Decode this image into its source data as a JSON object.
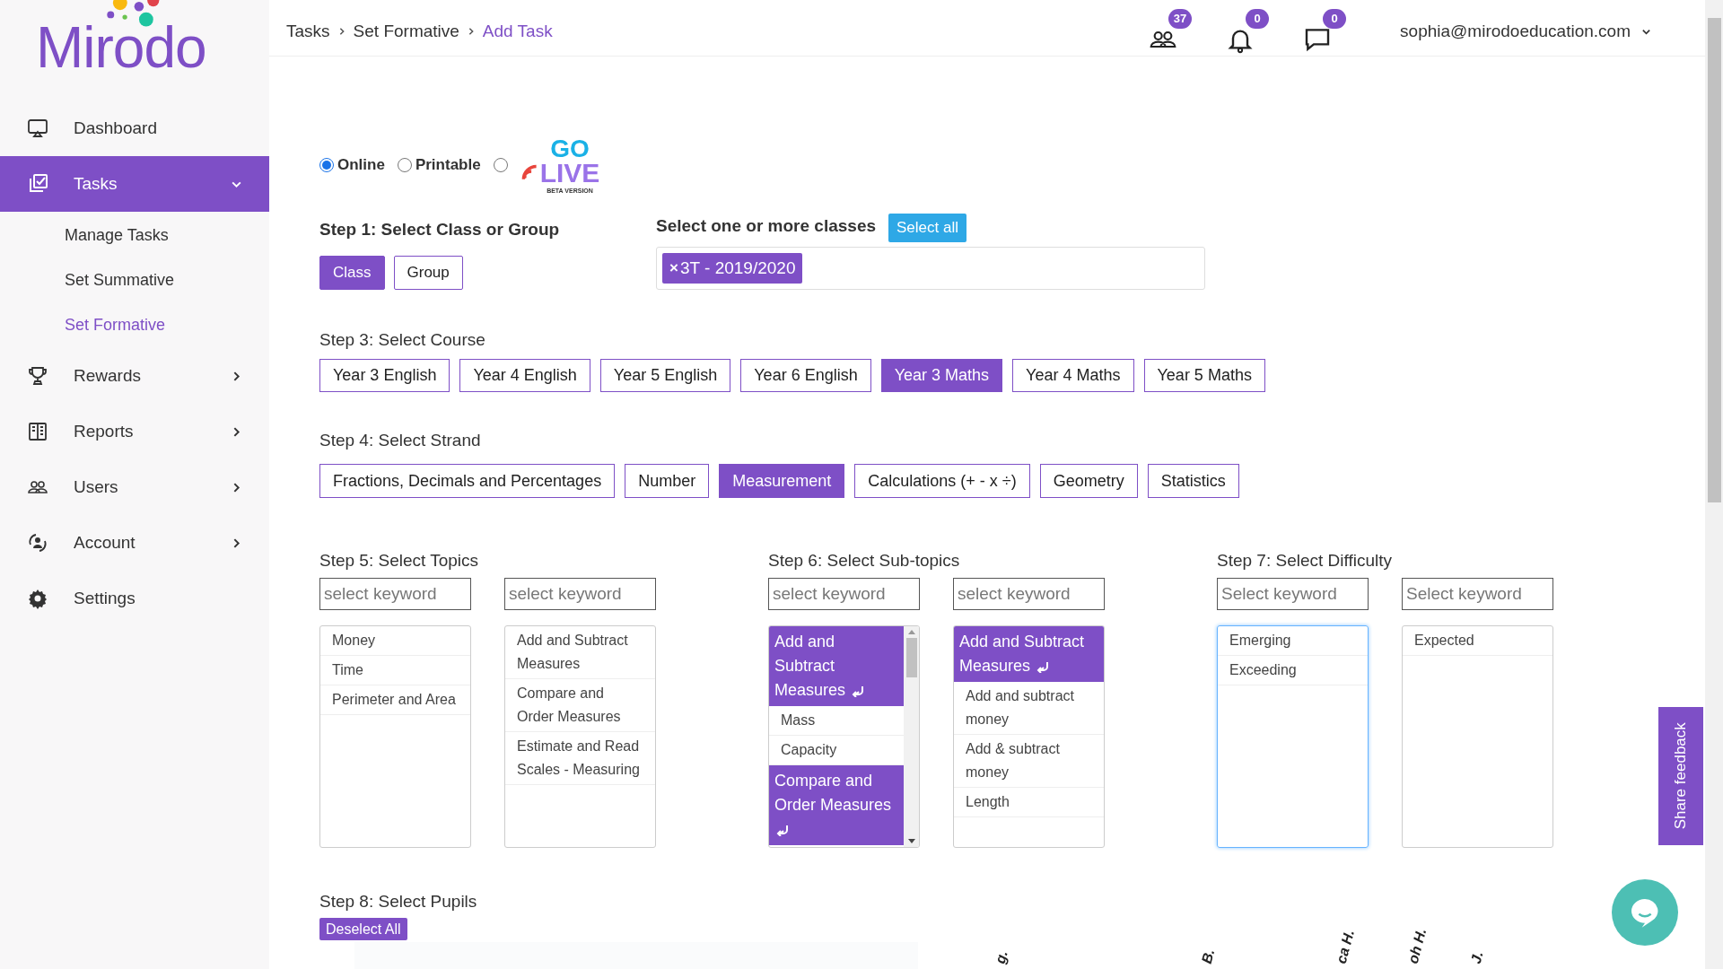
{
  "logo": {
    "text": "Mirodo"
  },
  "sidebar": {
    "items": [
      {
        "label": "Dashboard",
        "selected": false
      },
      {
        "label": "Tasks",
        "selected": true,
        "expanded": true,
        "children": [
          {
            "label": "Manage Tasks",
            "selected": false
          },
          {
            "label": "Set Summative",
            "selected": false
          },
          {
            "label": "Set Formative",
            "selected": true
          }
        ]
      },
      {
        "label": "Rewards",
        "selected": false,
        "expanded": false
      },
      {
        "label": "Reports",
        "selected": false,
        "expanded": false
      },
      {
        "label": "Users",
        "selected": false,
        "expanded": false
      },
      {
        "label": "Account",
        "selected": false,
        "expanded": false
      },
      {
        "label": "Settings",
        "selected": false
      }
    ]
  },
  "breadcrumb": [
    {
      "label": "Tasks",
      "current": false
    },
    {
      "label": "Set Formative",
      "current": false
    },
    {
      "label": "Add Task",
      "current": true
    }
  ],
  "header": {
    "badges": [
      {
        "count": "37"
      },
      {
        "count": "0"
      },
      {
        "count": "0"
      }
    ],
    "user": "sophia@mirodoeducation.com"
  },
  "modes": [
    {
      "kind": "text",
      "label": "Online",
      "selected": true
    },
    {
      "kind": "text",
      "label": "Printable",
      "selected": false
    },
    {
      "kind": "logo",
      "go": "GO",
      "live": "LIVE",
      "beta": "BETA VERSION",
      "selected": false
    }
  ],
  "step1": {
    "label": "Step 1: Select Class or Group",
    "options": [
      {
        "label": "Class",
        "selected": true
      },
      {
        "label": "Group",
        "selected": false
      }
    ]
  },
  "classes": {
    "label": "Select one or more classes",
    "select_all": "Select all",
    "tags": [
      {
        "remove": "×",
        "label": "3T - 2019/2020"
      }
    ]
  },
  "step3": {
    "label": "Step 3: Select Course",
    "options": [
      {
        "label": "Year 3 English",
        "selected": false
      },
      {
        "label": "Year 4 English",
        "selected": false
      },
      {
        "label": "Year 5 English",
        "selected": false
      },
      {
        "label": "Year 6 English",
        "selected": false
      },
      {
        "label": "Year 3 Maths",
        "selected": true
      },
      {
        "label": "Year 4 Maths",
        "selected": false
      },
      {
        "label": "Year 5 Maths",
        "selected": false
      }
    ]
  },
  "step4": {
    "label": "Step 4: Select Strand",
    "options": [
      {
        "label": "Fractions, Decimals and Percentages",
        "selected": false
      },
      {
        "label": "Number",
        "selected": false
      },
      {
        "label": "Measurement",
        "selected": true
      },
      {
        "label": "Calculations (+ - x ÷)",
        "selected": false
      },
      {
        "label": "Geometry",
        "selected": false
      },
      {
        "label": "Statistics",
        "selected": false
      }
    ]
  },
  "pickers": [
    {
      "label": "Step 5: Select Topics",
      "lists": [
        {
          "placeholder": "select keyword",
          "focused": false,
          "scrollbar": false,
          "items": [
            {
              "kind": "item",
              "label": "Money"
            },
            {
              "kind": "item",
              "label": "Time"
            },
            {
              "kind": "item",
              "label": "Perimeter and Area"
            }
          ]
        },
        {
          "placeholder": "select keyword",
          "focused": false,
          "scrollbar": false,
          "items": [
            {
              "kind": "item",
              "label": "Add and Subtract Measures"
            },
            {
              "kind": "item",
              "label": "Compare and Order Measures"
            },
            {
              "kind": "item",
              "label": "Estimate and Read Scales - Measuring"
            }
          ]
        }
      ]
    },
    {
      "label": "Step 6: Select Sub-topics",
      "lists": [
        {
          "placeholder": "select keyword",
          "focused": false,
          "scrollbar": true,
          "items": [
            {
              "kind": "group",
              "label": "Add and Subtract Measures"
            },
            {
              "kind": "item",
              "label": "Mass"
            },
            {
              "kind": "item",
              "label": "Capacity"
            },
            {
              "kind": "group",
              "label": "Compare and Order Measures"
            }
          ]
        },
        {
          "placeholder": "select keyword",
          "focused": false,
          "scrollbar": false,
          "items": [
            {
              "kind": "group",
              "label": "Add and Subtract Measures"
            },
            {
              "kind": "item",
              "label": "Add and subtract money"
            },
            {
              "kind": "item",
              "label": "Add & subtract money"
            },
            {
              "kind": "item",
              "label": "Length"
            }
          ]
        }
      ]
    },
    {
      "label": "Step 7: Select Difficulty",
      "lists": [
        {
          "placeholder": "Select keyword",
          "focused": true,
          "scrollbar": false,
          "items": [
            {
              "kind": "item",
              "label": "Emerging"
            },
            {
              "kind": "item",
              "label": "Exceeding"
            }
          ]
        },
        {
          "placeholder": "Select keyword",
          "focused": false,
          "scrollbar": false,
          "items": [
            {
              "kind": "item",
              "label": "Expected"
            }
          ]
        }
      ]
    }
  ],
  "step8": {
    "label": "Step 8: Select Pupils",
    "deselect": "Deselect All",
    "pupils": [
      "g.",
      "B.",
      "ca H.",
      "oh H.",
      "J."
    ]
  },
  "feedback": "Share feedback"
}
